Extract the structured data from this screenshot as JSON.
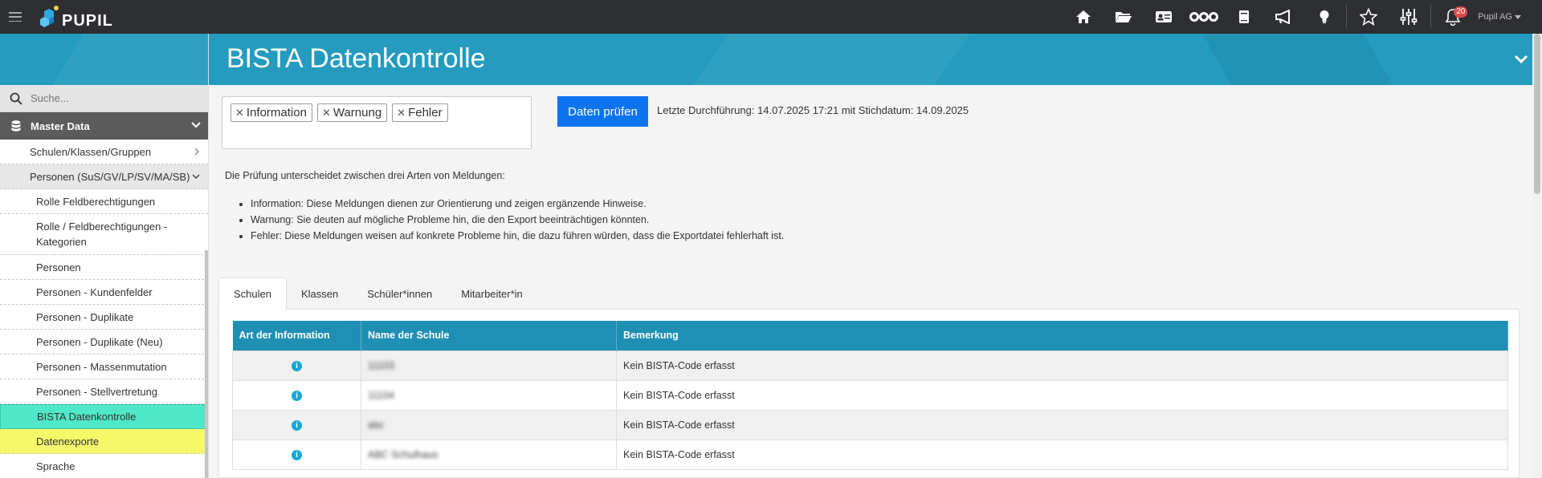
{
  "app": {
    "logo_text": "PUPIL",
    "user": "Pupil AG",
    "notifications": "20"
  },
  "topnav": [
    "home-icon",
    "folder-icon",
    "id-card-icon",
    "nodes-icon",
    "book-icon",
    "megaphone-icon",
    "lightbulb-icon",
    "star-icon",
    "sliders-icon",
    "bell-icon"
  ],
  "sidebar": {
    "search_placeholder": "Suche...",
    "section": "Master Data",
    "groups": [
      {
        "label": "Schulen/Klassen/Gruppen"
      },
      {
        "label": "Personen (SuS/GV/LP/SV/MA/SB)"
      }
    ],
    "items": [
      {
        "label": "Rolle Feldberechtigungen"
      },
      {
        "label": "Rolle / Feldberechtigungen - Kategorien"
      },
      {
        "label": "Personen"
      },
      {
        "label": "Personen - Kundenfelder"
      },
      {
        "label": "Personen - Duplikate"
      },
      {
        "label": "Personen - Duplikate (Neu)"
      },
      {
        "label": "Personen - Massenmutation"
      },
      {
        "label": "Personen - Stellvertretung"
      },
      {
        "label": "BISTA Datenkontrolle"
      },
      {
        "label": "Datenexporte"
      },
      {
        "label": "Sprache"
      }
    ]
  },
  "page": {
    "title": "BISTA Datenkontrolle",
    "filters": [
      "Information",
      "Warnung",
      "Fehler"
    ],
    "check_button": "Daten prüfen",
    "last_run": "Letzte Durchführung: 14.07.2025 17:21 mit Stichdatum: 14.09.2025",
    "intro": "Die Prüfung unterscheidet zwischen drei Arten von Meldungen:",
    "bullets": [
      "Information: Diese Meldungen dienen zur Orientierung und zeigen ergänzende Hinweise.",
      "Warnung: Sie deuten auf mögliche Probleme hin, die den Export beeinträchtigen könnten.",
      "Fehler: Diese Meldungen weisen auf konkrete Probleme hin, die dazu führen würden, dass die Exportdatei fehlerhaft ist."
    ],
    "tabs": [
      "Schulen",
      "Klassen",
      "Schüler*innen",
      "Mitarbeiter*in"
    ],
    "table": {
      "headers": [
        "Art der Information",
        "Name der Schule",
        "Bemerkung"
      ],
      "rows": [
        {
          "type": "info-icon",
          "name": "11103",
          "remark": "Kein BISTA-Code erfasst"
        },
        {
          "type": "info-icon",
          "name": "11104",
          "remark": "Kein BISTA-Code erfasst"
        },
        {
          "type": "info-icon",
          "name": "abc",
          "remark": "Kein BISTA-Code erfasst"
        },
        {
          "type": "info-icon",
          "name": "ABC Schulhaus",
          "remark": "Kein BISTA-Code erfasst"
        }
      ]
    }
  },
  "colors": {
    "topbar": "#2e2f33",
    "header": "#249bbf",
    "table_header": "#1f8fb4",
    "primary_button": "#0d74f0",
    "active_item": "#4fe8c8",
    "highlight_item": "#f7f76a"
  }
}
